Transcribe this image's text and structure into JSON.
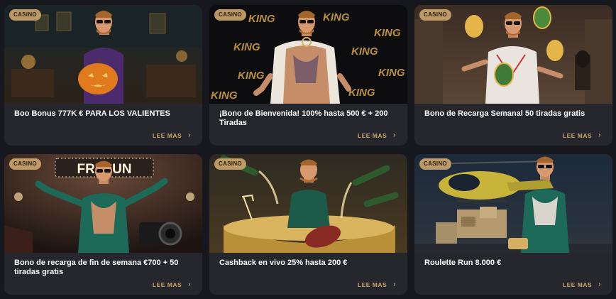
{
  "accent_color": "#c9a46b",
  "card_bg": "#26272c",
  "page_bg": "#17181d",
  "promos": [
    {
      "badge": "CASINO",
      "title": "Boo Bonus 777K € PARA LOS VALIENTES",
      "link": "LEE MAS",
      "image": "halloween-pumpkin-promo-image"
    },
    {
      "badge": "CASINO",
      "title": "¡Bono de Bienvenida! 100% hasta 500 € + 200 Tiradas",
      "link": "LEE MAS",
      "image": "king-welcome-promo-image",
      "bg_word": "KING"
    },
    {
      "badge": "CASINO",
      "title": "Bono de Recarga Semanal 50 tiradas gratis",
      "link": "LEE MAS",
      "image": "golden-eggs-promo-image"
    },
    {
      "badge": "CASINO",
      "title": "Bono de recarga de fin de semana €700 + 50 tiradas gratis",
      "link": "LEE MAS",
      "image": "fri-sun-promo-image",
      "sign": "FRI-SUN"
    },
    {
      "badge": "CASINO",
      "title": "Cashback en vivo 25% hasta 200 €",
      "link": "LEE MAS",
      "image": "champagne-bath-promo-image"
    },
    {
      "badge": "CASINO",
      "title": "Roulette Run 8.000 €",
      "link": "LEE MAS",
      "image": "helicopter-promo-image"
    }
  ]
}
